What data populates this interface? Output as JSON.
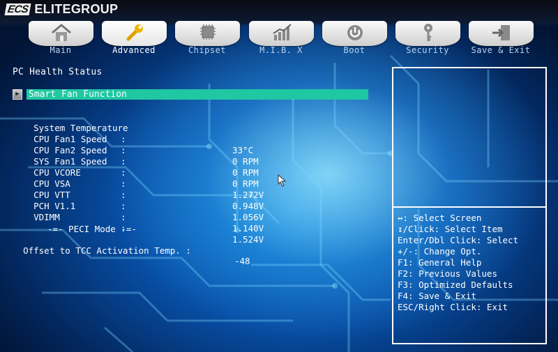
{
  "brand": {
    "mark": "ECS",
    "name": "ELITEGROUP"
  },
  "tabs": [
    {
      "label": "Main",
      "icon": "home-icon",
      "active": false
    },
    {
      "label": "Advanced",
      "icon": "wrench-icon",
      "active": true
    },
    {
      "label": "Chipset",
      "icon": "chip-icon",
      "active": false
    },
    {
      "label": "M.I.B. X",
      "icon": "bar-graph-icon",
      "active": false
    },
    {
      "label": "Boot",
      "icon": "power-icon",
      "active": false
    },
    {
      "label": "Security",
      "icon": "key-icon",
      "active": false
    },
    {
      "label": "Save & Exit",
      "icon": "exit-door-icon",
      "active": false
    }
  ],
  "page": {
    "title": "PC Health Status",
    "smart_fan": "Smart Fan Function"
  },
  "sensors": [
    {
      "label": "System Temperature",
      "colon": ":",
      "value": "33°C"
    },
    {
      "label": "CPU Fan1 Speed",
      "colon": ":",
      "value": "0 RPM"
    },
    {
      "label": "CPU Fan2 Speed",
      "colon": ":",
      "value": "0 RPM"
    },
    {
      "label": "SYS Fan1 Speed",
      "colon": ":",
      "value": "0 RPM"
    },
    {
      "label": "CPU VCORE",
      "colon": ":",
      "value": "1.272V"
    },
    {
      "label": "CPU VSA",
      "colon": ":",
      "value": "0.948V"
    },
    {
      "label": "CPU VTT",
      "colon": ":",
      "value": "1.056V"
    },
    {
      "label": "PCH V1.1",
      "colon": ":",
      "value": "1.140V"
    },
    {
      "label": "VDIMM",
      "colon": ":",
      "value": "1.524V"
    }
  ],
  "peci": {
    "header": "-=- PECI Mode -=-",
    "tcc_label": "Offset to TCC Activation Temp. :",
    "tcc_value": "-48"
  },
  "help": [
    "↔: Select Screen",
    "↕/Click: Select Item",
    "Enter/Dbl Click: Select",
    "+/-: Change Opt.",
    "F1: General Help",
    "F2: Previous Values",
    "F3: Optimized Defaults",
    "F4: Save & Exit",
    "ESC/Right Click: Exit"
  ],
  "colors": {
    "highlight": "#1fc7a2",
    "background": "#0850a8",
    "text": "#ffffff"
  }
}
